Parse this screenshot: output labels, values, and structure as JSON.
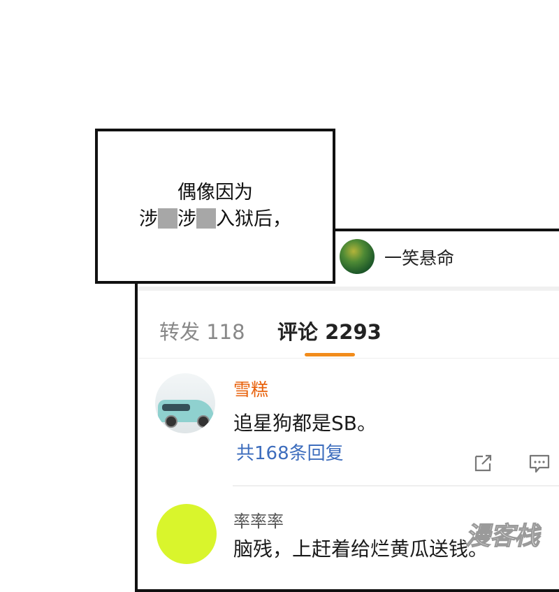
{
  "caption": {
    "line1": "偶像因为",
    "line2_part1": "涉",
    "line2_part2": "涉",
    "line2_part3": "入狱后，"
  },
  "post": {
    "username": "一笑悬命"
  },
  "tabs": {
    "repost_label": "转发 118",
    "comments_label": "评论 2293"
  },
  "comments": [
    {
      "username": "雪糕",
      "text": "追星狗都是SB。",
      "replies": "共168条回复"
    },
    {
      "username": "率率率",
      "text": "脑残，上赶着给烂黄瓜送钱。"
    }
  ],
  "colors": {
    "accent": "#f28c1b",
    "username": "#e8620c",
    "link": "#3d6dbd",
    "censor": "#a7a7a7"
  },
  "icons": {
    "share": "share-icon",
    "comment": "comment-icon"
  },
  "watermark": "漫客栈"
}
